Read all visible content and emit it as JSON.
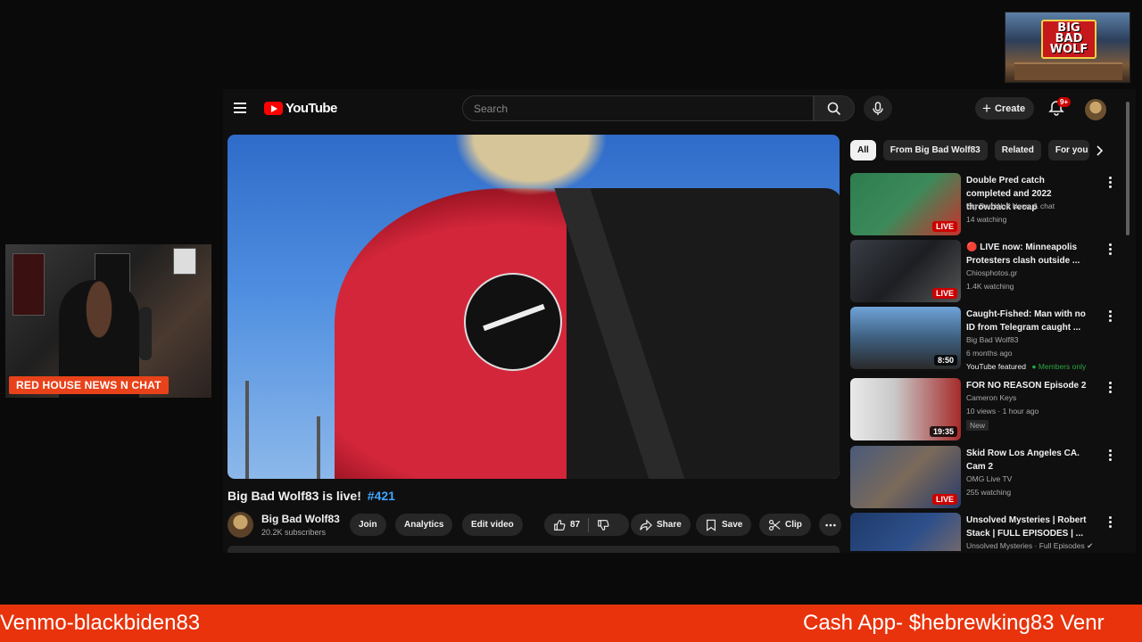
{
  "logo_overlay": {
    "text_line1": "BIG BAD",
    "text_line2": "WOLF"
  },
  "webcam": {
    "banner": "RED HOUSE NEWS N CHAT"
  },
  "youtube": {
    "logo_text": "YouTube",
    "search": {
      "placeholder": "Search"
    },
    "create_label": "Create",
    "notification_count": "9+",
    "video": {
      "title": "Big Bad Wolf83 is live!",
      "hashtag": "#421"
    },
    "channel": {
      "name": "Big Bad Wolf83",
      "subscribers": "20.2K subscribers"
    },
    "actions": {
      "join": "Join",
      "analytics": "Analytics",
      "edit_video": "Edit video",
      "likes": "87",
      "share": "Share",
      "save": "Save",
      "clip": "Clip"
    },
    "chips": [
      "All",
      "From Big Bad Wolf83",
      "Related",
      "For you"
    ],
    "recommendations": [
      {
        "title": "Double Pred catch completed and 2022 throwback recap",
        "channel": "Big Bad Wolf News & chat",
        "meta": "14 watching",
        "badge": "LIVE"
      },
      {
        "title": "🔴 LIVE now: Minneapolis Protesters clash outside ...",
        "channel": "Chiosphotos.gr",
        "meta": "1.4K watching",
        "badge": "LIVE"
      },
      {
        "title": "Caught-Fished: Man with no ID from Telegram caught ...",
        "channel": "Big Bad Wolf83",
        "meta": "6 months ago",
        "extra": "YouTube featured",
        "members": "Members only",
        "badge": "8:50"
      },
      {
        "title": "FOR NO REASON Episode 2",
        "channel": "Cameron Keys",
        "meta": "10 views · 1 hour ago",
        "new": "New",
        "badge": "19:35"
      },
      {
        "title": "Skid Row Los Angeles CA. Cam 2",
        "channel": "OMG Live TV",
        "meta": "255 watching",
        "badge": "LIVE"
      },
      {
        "title": "Unsolved Mysteries | Robert Stack | FULL EPISODES | ...",
        "channel": "Unsolved Mysteries · Full Episodes ✔",
        "meta": "",
        "badge": ""
      }
    ]
  },
  "ticker": {
    "left": "Venmo-blackbiden83",
    "right": "Cash App- $hebrewking83 Venr"
  },
  "colors": {
    "ticker_bg": "#e8330c",
    "live_red": "#cc0000",
    "link_blue": "#3ea6ff",
    "members_green": "#2ba640"
  }
}
